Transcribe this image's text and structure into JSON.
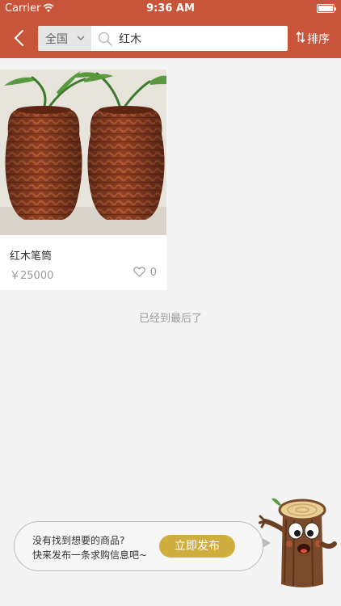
{
  "status_bar": {
    "carrier": "Carrier",
    "time": "9:36 AM",
    "battery_level": 1.0
  },
  "nav": {
    "back_icon": "chevron-left-icon",
    "region": "全国",
    "search_query": "红木",
    "sort_label": "排序",
    "accent_color": "#c8553a"
  },
  "products": [
    {
      "title": "红木笔筒",
      "price": "￥25000",
      "likes": "0",
      "image": "two-woven-redwood-vases-with-bamboo"
    }
  ],
  "list_end_message": "已经到最后了",
  "prompt": {
    "line1": "没有找到想要的商品?",
    "line2": "快来发布一条求购信息吧~",
    "publish_label": "立即发布",
    "button_color": "#cfae3f",
    "mascot": "wood-stump-mascot-icon"
  }
}
